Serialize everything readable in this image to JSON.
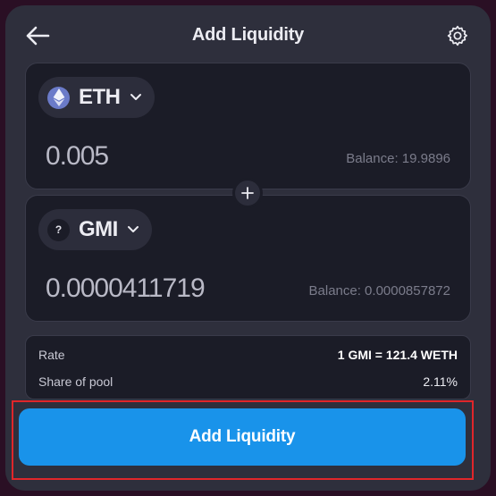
{
  "header": {
    "title": "Add Liquidity",
    "back_icon": "arrow-left-icon",
    "settings_icon": "gear-icon"
  },
  "token_a": {
    "symbol": "ETH",
    "icon": "ethereum-icon",
    "amount": "0.005",
    "balance": "Balance: 19.9896"
  },
  "token_b": {
    "symbol": "GMI",
    "icon_glyph": "?",
    "amount": "0.0000411719",
    "balance": "Balance: 0.0000857872"
  },
  "info": {
    "rate_label": "Rate",
    "rate_value": "1 GMI = 121.4 WETH",
    "share_label": "Share of pool",
    "share_value": "2.11%"
  },
  "cta": {
    "label": "Add Liquidity"
  },
  "colors": {
    "page_bg": "#2a0f24",
    "panel_bg": "#2e2f3c",
    "card_bg": "#1b1c27",
    "accent": "#1993ea",
    "highlight": "#e0262a"
  }
}
